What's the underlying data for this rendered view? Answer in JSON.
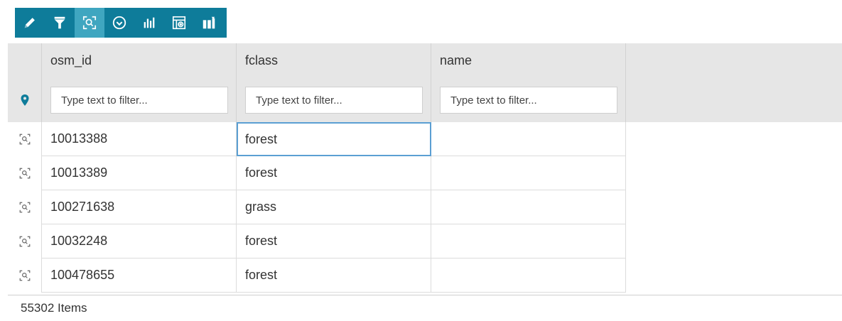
{
  "toolbar": {
    "buttons": [
      {
        "icon": "pencil-icon"
      },
      {
        "icon": "filter-icon"
      },
      {
        "icon": "zoom-to-selection-icon",
        "active": true
      },
      {
        "icon": "circle-download-icon"
      },
      {
        "icon": "bar-chart-icon"
      },
      {
        "icon": "table-options-icon"
      },
      {
        "icon": "layout-icon"
      }
    ],
    "background": "#0e7c9a",
    "active_background": "#3fa6c0"
  },
  "grid": {
    "columns": [
      {
        "label": "osm_id"
      },
      {
        "label": "fclass"
      },
      {
        "label": "name"
      }
    ],
    "filter_placeholder": "Type text to filter...",
    "filter_row_icon": "map-pin-icon",
    "rows": [
      {
        "osm_id": "10013388",
        "fclass": "forest",
        "name": ""
      },
      {
        "osm_id": "10013389",
        "fclass": "forest",
        "name": ""
      },
      {
        "osm_id": "100271638",
        "fclass": "grass",
        "name": ""
      },
      {
        "osm_id": "10032248",
        "fclass": "forest",
        "name": ""
      },
      {
        "osm_id": "100478655",
        "fclass": "forest",
        "name": ""
      }
    ],
    "selected_cell": {
      "row": 0,
      "column": "fclass"
    }
  },
  "footer": {
    "items_text": "55302 Items"
  }
}
